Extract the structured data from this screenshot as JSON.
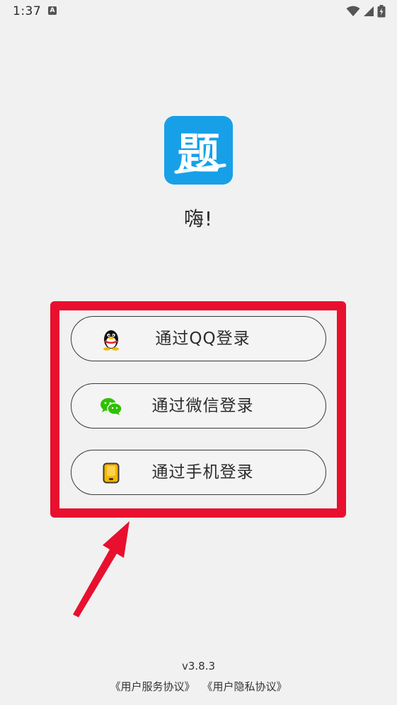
{
  "status_bar": {
    "time": "1:37",
    "notification_icon_letter": "A",
    "icons": [
      "wifi-icon",
      "signal-icon",
      "battery-charging-icon"
    ]
  },
  "app": {
    "logo_char": "题",
    "logo_color": "#17a0e8",
    "greeting": "嗨!"
  },
  "login_options": [
    {
      "label": "通过QQ登录",
      "icon": "qq-icon"
    },
    {
      "label": "通过微信登录",
      "icon": "wechat-icon"
    },
    {
      "label": "通过手机登录",
      "icon": "phone-icon"
    }
  ],
  "annotation": {
    "highlight_color": "#e8102e"
  },
  "footer": {
    "version": "v3.8.3",
    "user_service_agreement": "《用户服务协议》",
    "privacy_agreement": "《用户隐私协议》"
  }
}
